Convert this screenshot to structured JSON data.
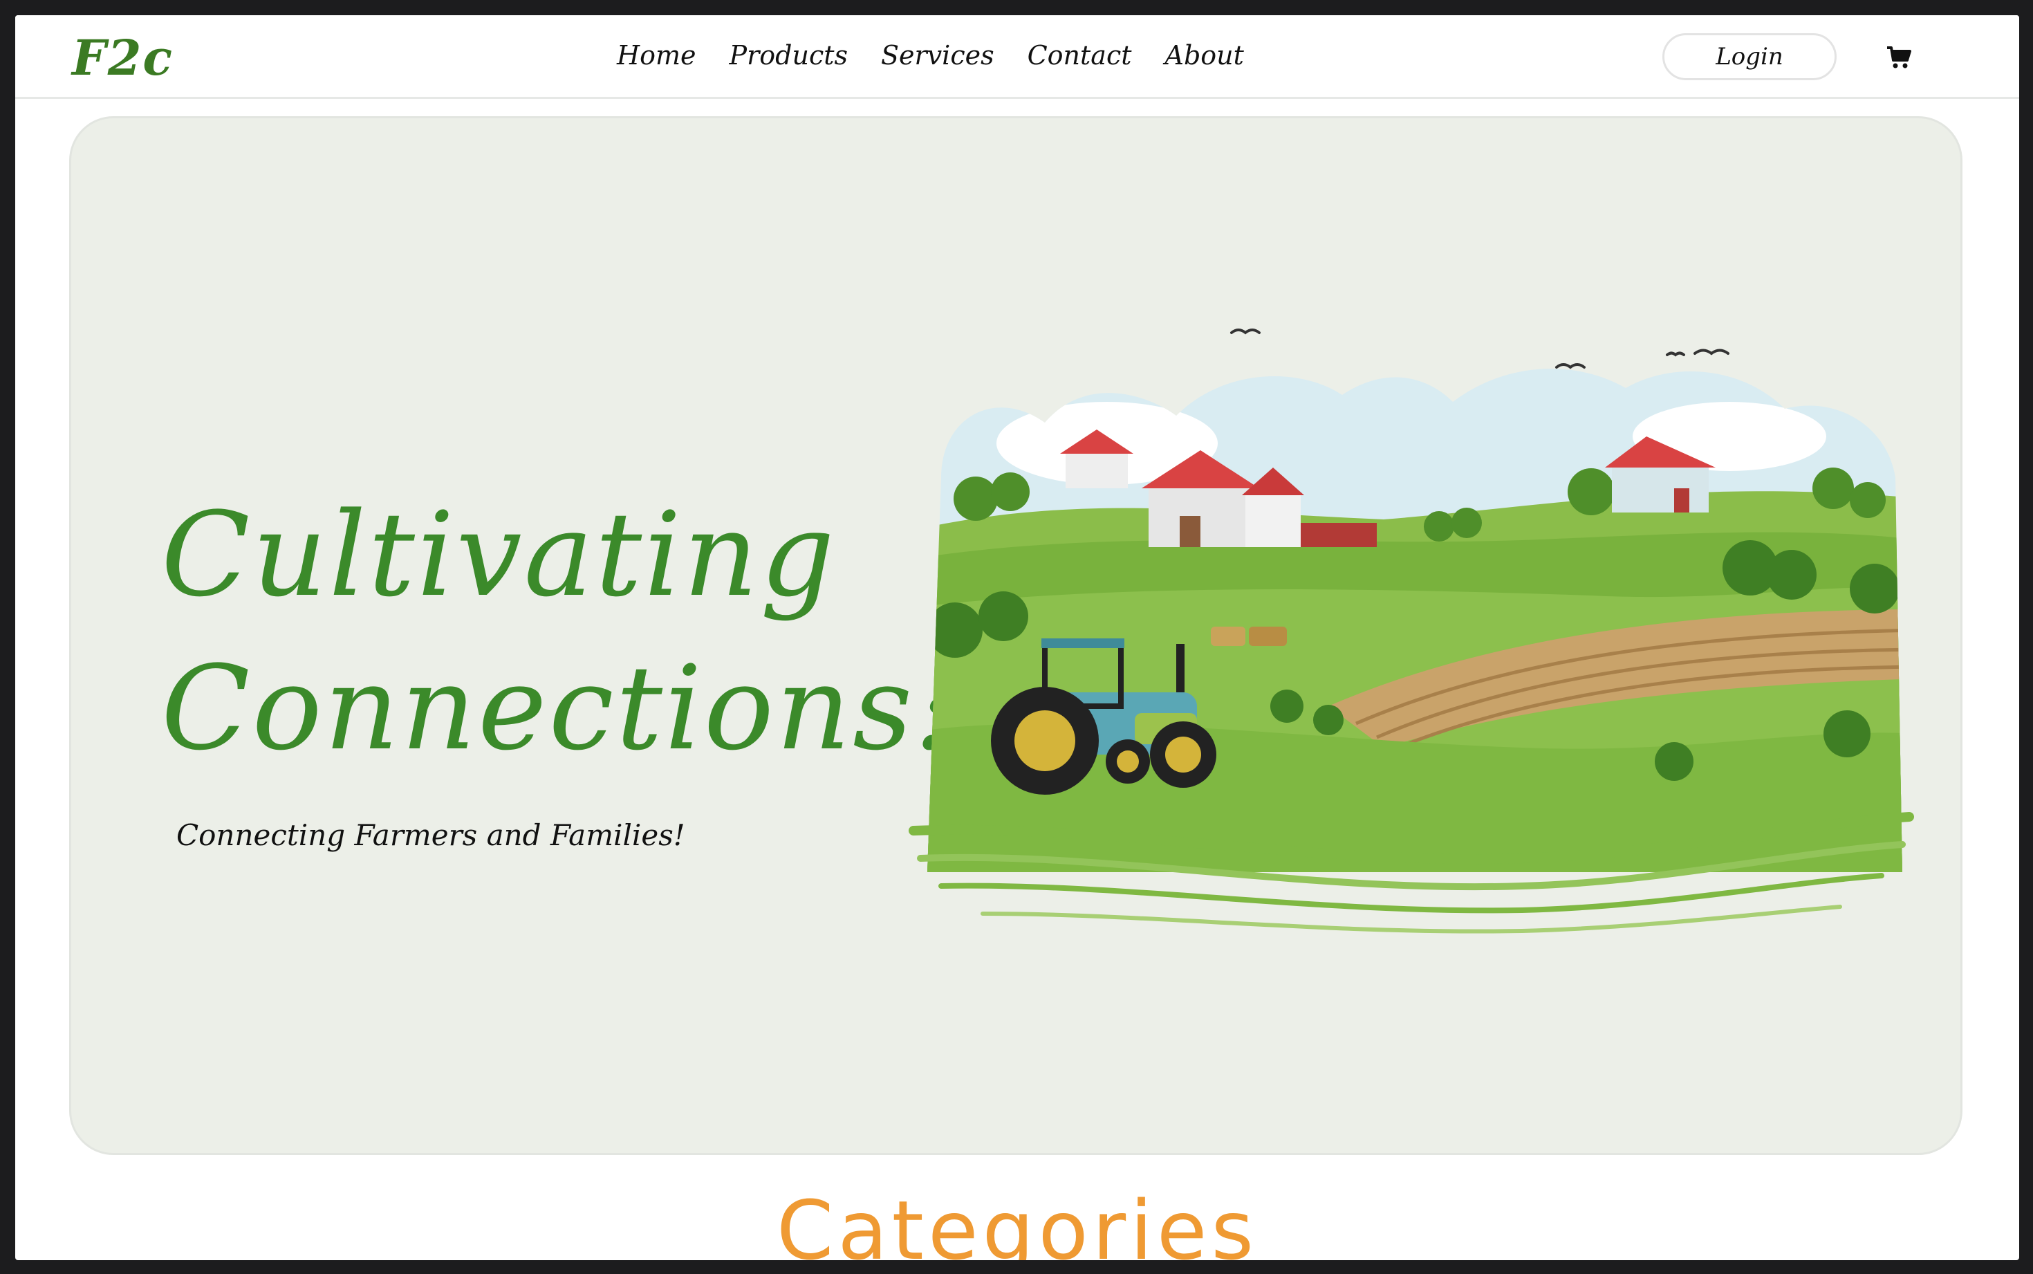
{
  "nav": {
    "logo": "F2c",
    "links": [
      "Home",
      "Products",
      "Services",
      "Contact",
      "About"
    ],
    "login": "Login",
    "cart_icon": "cart-icon"
  },
  "hero": {
    "title_line1": "Cultivating",
    "title_line2": "Connections:",
    "subtitle": "Connecting Farmers and Families!",
    "illustration": "farm-landscape-illustration"
  },
  "categories": {
    "heading": "Categories"
  },
  "colors": {
    "brand_green": "#3b8a2a",
    "hero_bg": "#ecefe8",
    "accent_orange": "#ef9a33"
  }
}
